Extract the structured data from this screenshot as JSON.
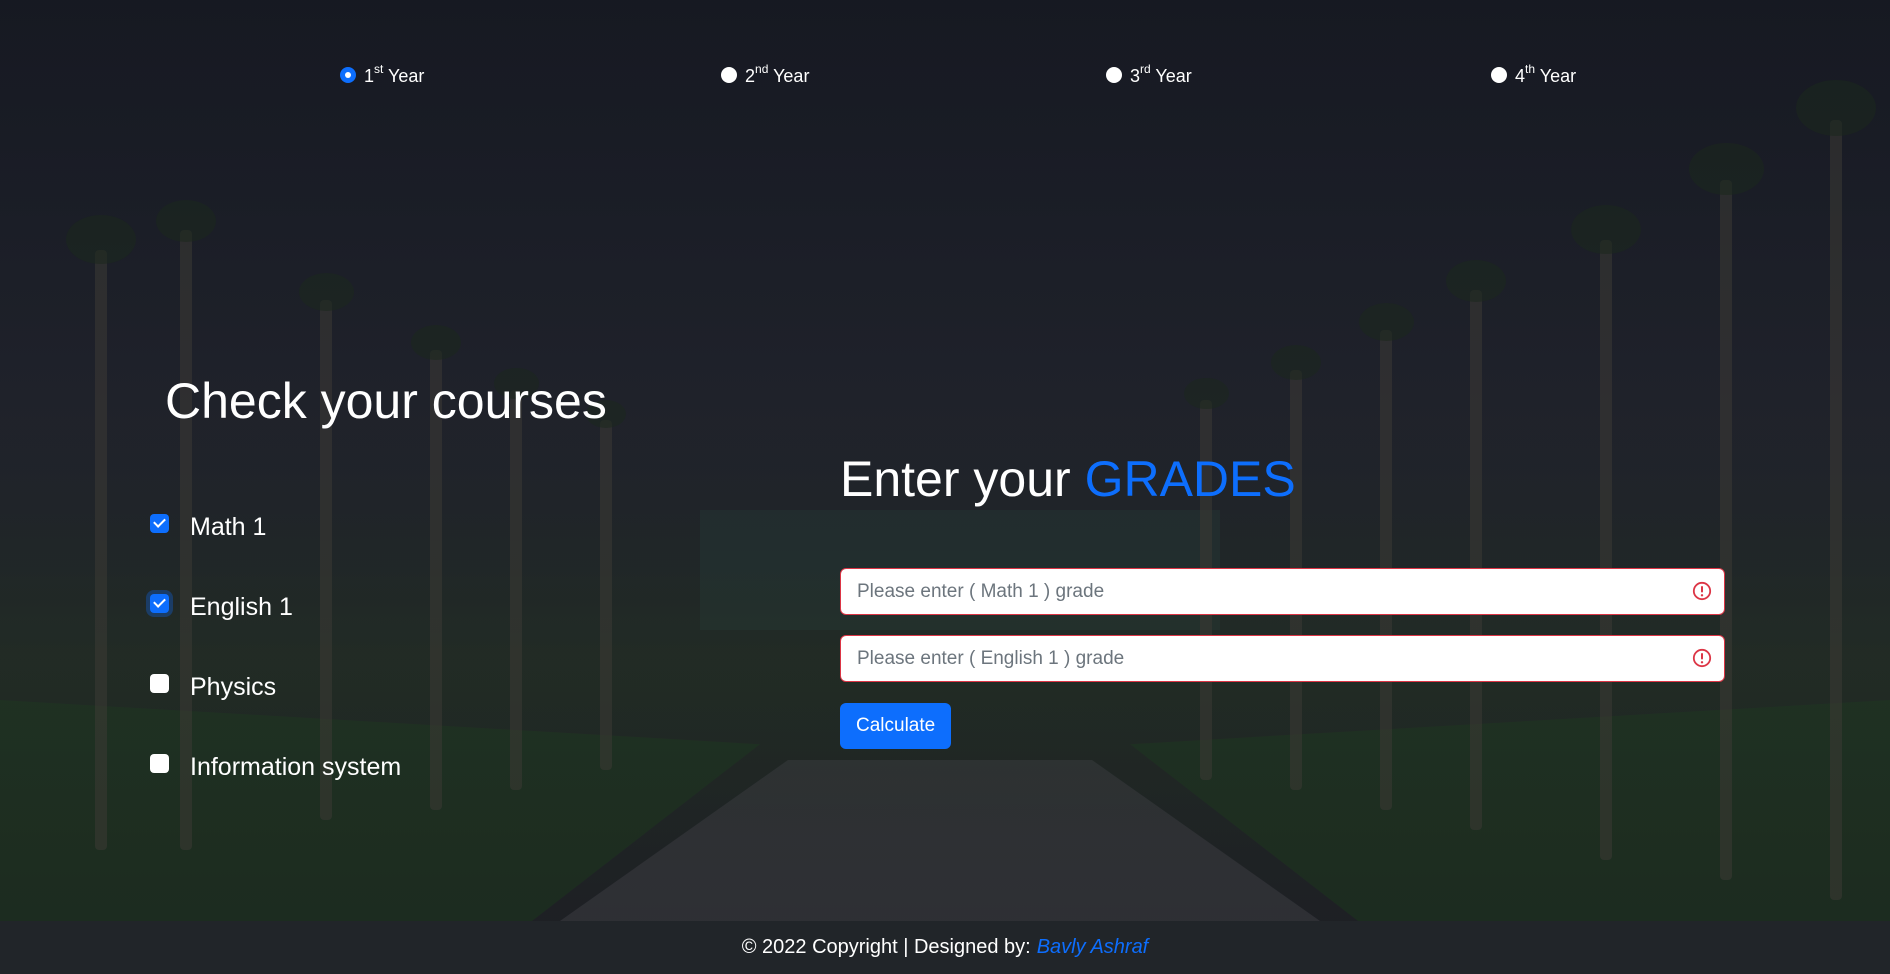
{
  "year_selector": {
    "options": [
      {
        "number": "1",
        "suffix": "st",
        "word": "Year",
        "selected": true
      },
      {
        "number": "2",
        "suffix": "nd",
        "word": "Year",
        "selected": false
      },
      {
        "number": "3",
        "suffix": "rd",
        "word": "Year",
        "selected": false
      },
      {
        "number": "4",
        "suffix": "th",
        "word": "Year",
        "selected": false
      }
    ]
  },
  "courses": {
    "title": "Check your courses",
    "items": [
      {
        "label": "Math 1",
        "checked": true
      },
      {
        "label": "English 1",
        "checked": true
      },
      {
        "label": "Physics",
        "checked": false
      },
      {
        "label": "Information system",
        "checked": false
      }
    ]
  },
  "grades": {
    "title_prefix": "Enter your",
    "title_accent": "GRADES",
    "inputs": [
      {
        "placeholder": "Please enter ( Math 1 ) grade",
        "value": ""
      },
      {
        "placeholder": "Please enter ( English 1 ) grade",
        "value": ""
      }
    ],
    "calculate_label": "Calculate"
  },
  "footer": {
    "text": "© 2022 Copyright | Designed by:",
    "author": "Bavly Ashraf"
  },
  "colors": {
    "accent": "#0d6efd",
    "invalid": "#dc3545",
    "footer_bg": "#212529"
  },
  "icons": {
    "invalid": "exclamation-circle-icon"
  }
}
